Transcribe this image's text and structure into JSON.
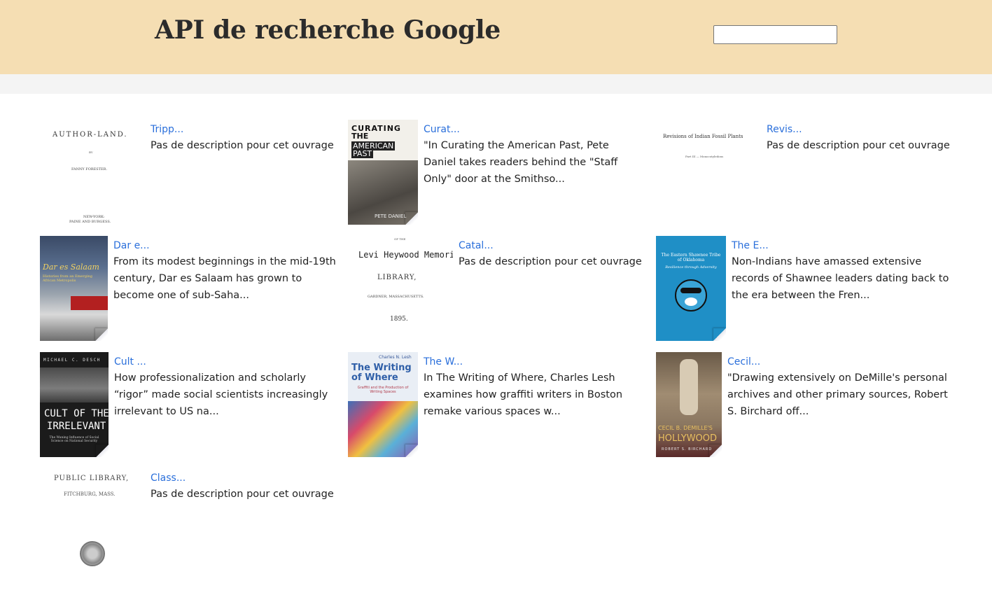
{
  "header": {
    "title": "API de recherche Google",
    "search_value": ""
  },
  "books": [
    {
      "title": "Tripp...",
      "description": "Pas de description pour cet ouvrage",
      "cover_text": [
        "AUTHOR-LAND.",
        "BY",
        "FANNY FORESTER.",
        "NEW-YORK:",
        "PAINE AND BURGESS."
      ]
    },
    {
      "title": "Curat...",
      "description": "\"In Curating the American Past, Pete Daniel takes readers behind the \"Staff Only\" door at the Smithso...",
      "cover_text": [
        "CURATING",
        "THE",
        "AMERICAN",
        "PAST",
        "PETE DANIEL"
      ]
    },
    {
      "title": "Revis...",
      "description": "Pas de description pour cet ouvrage",
      "cover_text": [
        "Revisions of Indian Fossil Plants",
        "Part III — Monocotyledons"
      ]
    },
    {
      "title": "Dar e...",
      "description": "From its modest beginnings in the mid-19th century, Dar es Salaam has grown to become one of sub-Saha...",
      "cover_text": [
        "Dar es Salaam",
        "Histories from an Emerging African Metropolis"
      ]
    },
    {
      "title": "Catal...",
      "description": "Pas de description pour cet ouvrage",
      "cover_text": [
        "OF THE",
        "Levi Heywood Memorial",
        "LIBRARY,",
        "GARDNER, MASSACHUSETTS.",
        "1895."
      ]
    },
    {
      "title": "The E...",
      "description": "Non-Indians have amassed extensive records of Shawnee leaders dating back to the era between the Fren...",
      "cover_text": [
        "The Eastern Shawnee Tribe of Oklahoma",
        "Resilience through Adversity"
      ]
    },
    {
      "title": "Cult ...",
      "description": "How professionalization and scholarly “rigor” made social scientists increasingly irrelevant to US na...",
      "cover_text": [
        "MICHAEL C. DESCH",
        "CULT OF THE",
        "IRRELEVANT",
        "The Waning Influence of Social Science on National Security"
      ]
    },
    {
      "title": "The W...",
      "description": "In The Writing of Where, Charles Lesh examines how graffiti writers in Boston remake various spaces w...",
      "cover_text": [
        "Charles N. Lesh",
        "The Writing of Where",
        "Graffiti and the Production of Writing Spaces"
      ]
    },
    {
      "title": "Cecil...",
      "description": "\"Drawing extensively on DeMille's personal archives and other primary sources, Robert S. Birchard off...",
      "cover_text": [
        "CECIL B. DEMILLE'S",
        "HOLLYWOOD",
        "ROBERT S. BIRCHARD"
      ]
    },
    {
      "title": "Class...",
      "description": "Pas de description pour cet ouvrage",
      "cover_text": [
        "PUBLIC LIBRARY,",
        "FITCHBURG, MASS."
      ]
    }
  ]
}
